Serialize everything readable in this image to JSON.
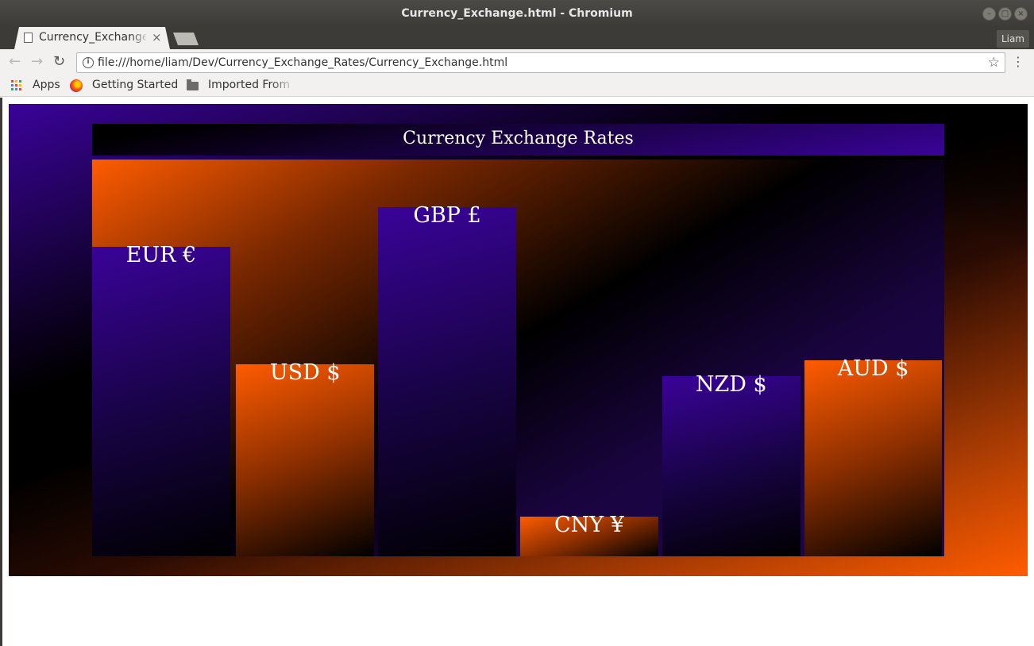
{
  "window": {
    "title": "Currency_Exchange.html - Chromium"
  },
  "tab": {
    "title": "Currency_Exchange",
    "close": "×"
  },
  "profile": {
    "name": "Liam"
  },
  "toolbar": {
    "back": "←",
    "forward": "→",
    "reload": "↻",
    "url": "file:///home/liam/Dev/Currency_Exchange_Rates/Currency_Exchange.html",
    "star": "☆",
    "menu": "⋮",
    "info": "i"
  },
  "bookmarks": [
    {
      "label": "Apps",
      "icon": "apps-grid-icon"
    },
    {
      "label": "Getting Started",
      "icon": "firefox-icon"
    },
    {
      "label": "Imported From",
      "icon": "folder-icon"
    }
  ],
  "colors": {
    "purple": "#3a0399",
    "orange": "#ff5c00",
    "black": "#000000"
  },
  "chart_data": {
    "type": "bar",
    "title": "Currency Exchange Rates",
    "categories": [
      "EUR €",
      "USD $",
      "GBP £",
      "CNY ¥",
      "NZD $",
      "AUD $"
    ],
    "values": [
      78,
      48.5,
      88,
      10,
      45.5,
      49.5
    ],
    "bar_colors": [
      "purple",
      "orange",
      "purple",
      "orange",
      "purple",
      "orange"
    ],
    "ylim": [
      0,
      100
    ],
    "grid": false,
    "xlabel": "",
    "ylabel": ""
  }
}
